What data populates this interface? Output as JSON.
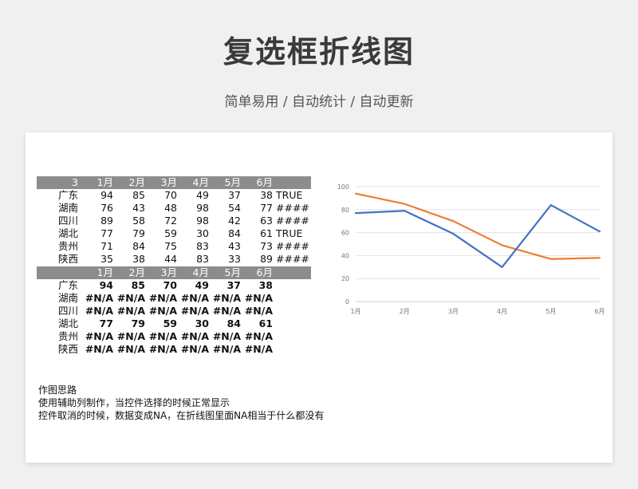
{
  "page": {
    "title": "复选框折线图",
    "subtitle": "简单易用 / 自动统计 / 自动更新"
  },
  "table1": {
    "corner": "3",
    "months": [
      "1月",
      "2月",
      "3月",
      "4月",
      "5月",
      "6月"
    ],
    "rows": [
      {
        "region": "广东",
        "values": [
          "94",
          "85",
          "70",
          "49",
          "37",
          "38"
        ],
        "flag": "TRUE"
      },
      {
        "region": "湖南",
        "values": [
          "76",
          "43",
          "48",
          "98",
          "54",
          "77"
        ],
        "flag": "####"
      },
      {
        "region": "四川",
        "values": [
          "89",
          "58",
          "72",
          "98",
          "42",
          "63"
        ],
        "flag": "####"
      },
      {
        "region": "湖北",
        "values": [
          "77",
          "79",
          "59",
          "30",
          "84",
          "61"
        ],
        "flag": "TRUE"
      },
      {
        "region": "贵州",
        "values": [
          "71",
          "84",
          "75",
          "83",
          "43",
          "73"
        ],
        "flag": "####"
      },
      {
        "region": "陕西",
        "values": [
          "35",
          "38",
          "44",
          "83",
          "33",
          "89"
        ],
        "flag": "####"
      }
    ]
  },
  "table2": {
    "months": [
      "1月",
      "2月",
      "3月",
      "4月",
      "5月",
      "6月"
    ],
    "rows": [
      {
        "region": "广东",
        "values": [
          "94",
          "85",
          "70",
          "49",
          "37",
          "38"
        ]
      },
      {
        "region": "湖南",
        "values": [
          "#N/A",
          "#N/A",
          "#N/A",
          "#N/A",
          "#N/A",
          "#N/A"
        ]
      },
      {
        "region": "四川",
        "values": [
          "#N/A",
          "#N/A",
          "#N/A",
          "#N/A",
          "#N/A",
          "#N/A"
        ]
      },
      {
        "region": "湖北",
        "values": [
          "77",
          "79",
          "59",
          "30",
          "84",
          "61"
        ]
      },
      {
        "region": "贵州",
        "values": [
          "#N/A",
          "#N/A",
          "#N/A",
          "#N/A",
          "#N/A",
          "#N/A"
        ]
      },
      {
        "region": "陕西",
        "values": [
          "#N/A",
          "#N/A",
          "#N/A",
          "#N/A",
          "#N/A",
          "#N/A"
        ]
      }
    ]
  },
  "notes": {
    "heading": "作图思路",
    "line1": "使用辅助列制作，当控件选择的时候正常显示",
    "line2": "控件取消的时候，数据变成NA，在折线图里面NA相当于什么都没有"
  },
  "chart_data": {
    "type": "line",
    "categories": [
      "1月",
      "2月",
      "3月",
      "4月",
      "5月",
      "6月"
    ],
    "ylim": [
      0,
      100
    ],
    "yticks": [
      "0",
      "20",
      "40",
      "60",
      "80",
      "100"
    ],
    "grid": true,
    "series": [
      {
        "values": [
          94,
          85,
          70,
          49,
          37,
          38
        ],
        "color": "#ed7d31"
      },
      {
        "values": [
          77,
          79,
          59,
          30,
          84,
          61
        ],
        "color": "#4472c4"
      }
    ]
  }
}
